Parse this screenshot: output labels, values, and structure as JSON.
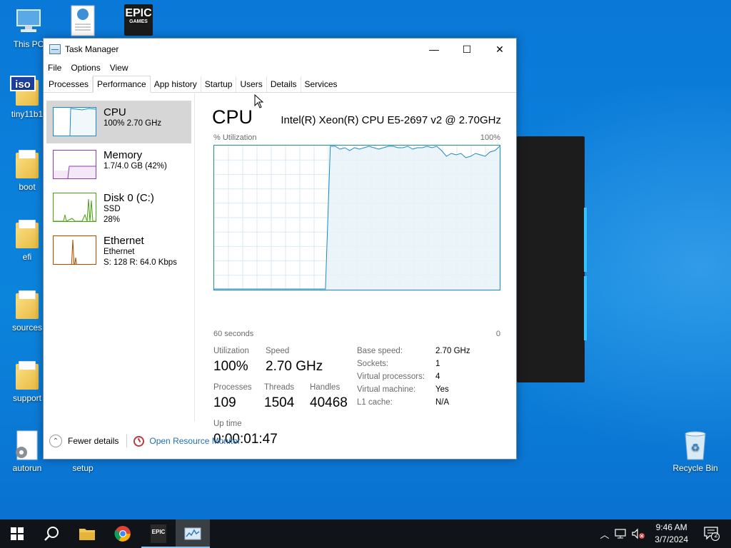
{
  "desktop": {
    "icons": [
      {
        "label": "This PC"
      },
      {
        "label": ""
      },
      {
        "label": ""
      },
      {
        "label": "tiny11b1"
      },
      {
        "label": "boot"
      },
      {
        "label": "efi"
      },
      {
        "label": "sources"
      },
      {
        "label": "support"
      },
      {
        "label": "autorun"
      },
      {
        "label": "setup"
      },
      {
        "label": "Recycle Bin"
      }
    ],
    "epic_logo_text": "EPIC",
    "epic_logo_sub": "GAMES",
    "iso_badge": "iso"
  },
  "window": {
    "title": "Task Manager",
    "controls": {
      "minimize": "—",
      "maximize": "☐",
      "close": "✕"
    },
    "menu": [
      "File",
      "Options",
      "View"
    ],
    "tabs": [
      "Processes",
      "Performance",
      "App history",
      "Startup",
      "Users",
      "Details",
      "Services"
    ],
    "active_tab": "Performance"
  },
  "resources": [
    {
      "name": "CPU",
      "line1": "100%  2.70 GHz",
      "line2": "",
      "selected": true
    },
    {
      "name": "Memory",
      "line1": "1.7/4.0 GB (42%)",
      "line2": ""
    },
    {
      "name": "Disk 0 (C:)",
      "line1": "SSD",
      "line2": "28%"
    },
    {
      "name": "Ethernet",
      "line1": "Ethernet",
      "line2": "S: 128  R: 64.0 Kbps"
    }
  ],
  "cpu": {
    "title": "CPU",
    "model": "Intel(R) Xeon(R) CPU E5-2697 v2 @ 2.70GHz",
    "graph_ylabel": "% Utilization",
    "graph_ymax": "100%",
    "graph_xleft": "60 seconds",
    "graph_xright": "0",
    "stats": {
      "utilization_label": "Utilization",
      "utilization": "100%",
      "speed_label": "Speed",
      "speed": "2.70 GHz",
      "processes_label": "Processes",
      "processes": "109",
      "threads_label": "Threads",
      "threads": "1504",
      "handles_label": "Handles",
      "handles": "40468",
      "uptime_label": "Up time",
      "uptime": "0:00:01:47"
    },
    "details": [
      {
        "k": "Base speed:",
        "v": "2.70 GHz"
      },
      {
        "k": "Sockets:",
        "v": "1"
      },
      {
        "k": "Virtual processors:",
        "v": "4"
      },
      {
        "k": "Virtual machine:",
        "v": "Yes"
      },
      {
        "k": "L1 cache:",
        "v": "N/A"
      }
    ]
  },
  "chart_data": {
    "type": "area",
    "series": [
      {
        "values": [
          0,
          0,
          0,
          0,
          0,
          0,
          0,
          0,
          0,
          0,
          0,
          0,
          0,
          0,
          0,
          0,
          0,
          0,
          0,
          0,
          0,
          0,
          0,
          0,
          100,
          100,
          98,
          99,
          97,
          99,
          98,
          99,
          100,
          99,
          98,
          99,
          100,
          100,
          99,
          99,
          100,
          98,
          99,
          99,
          100,
          99,
          100,
          97,
          93,
          95,
          94,
          95,
          92,
          93,
          95,
          94,
          93,
          96,
          97,
          100
        ]
      }
    ],
    "ylim": [
      0,
      100
    ],
    "x_span_seconds": 60
  },
  "footer": {
    "fewer_details": "Fewer details",
    "open_resource_monitor": "Open Resource Monitor"
  },
  "taskbar": {
    "time": "9:46 AM",
    "date": "3/7/2024",
    "notification_count": "2",
    "epic_text": "EPIC"
  },
  "colors": {
    "cpu_accent": "#1a8ac4",
    "memory_accent": "#8b3fa7",
    "disk_accent": "#4ea017",
    "ethernet_accent": "#a74f01"
  }
}
